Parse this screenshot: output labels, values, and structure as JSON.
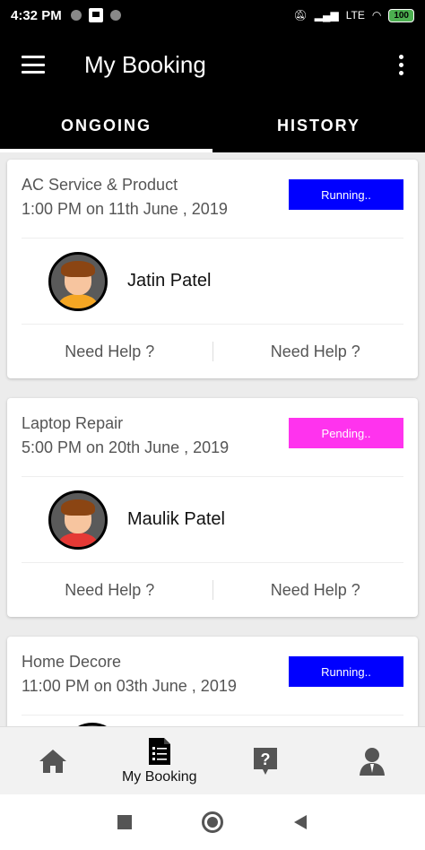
{
  "status_bar": {
    "time": "4:32 PM",
    "battery": "100",
    "network": "LTE"
  },
  "app_bar": {
    "title": "My Booking"
  },
  "tabs": [
    {
      "label": "ONGOING",
      "active": true
    },
    {
      "label": "HISTORY",
      "active": false
    }
  ],
  "bookings": [
    {
      "service": "AC Service & Product",
      "time": "1:00 PM on 11th June , 2019",
      "status": "Running..",
      "status_color": "#0000ff",
      "person": "Jatin Patel",
      "shirt_color": "#f5a623",
      "help_left": "Need Help ?",
      "help_right": "Need Help ?"
    },
    {
      "service": "Laptop Repair",
      "time": "5:00 PM on 20th June , 2019",
      "status": "Pending..",
      "status_color": "#ff33ee",
      "person": "Maulik Patel",
      "shirt_color": "#e53935",
      "help_left": "Need Help ?",
      "help_right": "Need Help ?"
    },
    {
      "service": "Home Decore",
      "time": "11:00 PM on 03th June , 2019",
      "status": "Running..",
      "status_color": "#0000ff"
    }
  ],
  "bottom_nav": {
    "items": [
      {
        "icon": "home-icon",
        "label": ""
      },
      {
        "icon": "booking-list-icon",
        "label": "My Booking"
      },
      {
        "icon": "help-icon",
        "label": ""
      },
      {
        "icon": "profile-icon",
        "label": ""
      }
    ]
  }
}
